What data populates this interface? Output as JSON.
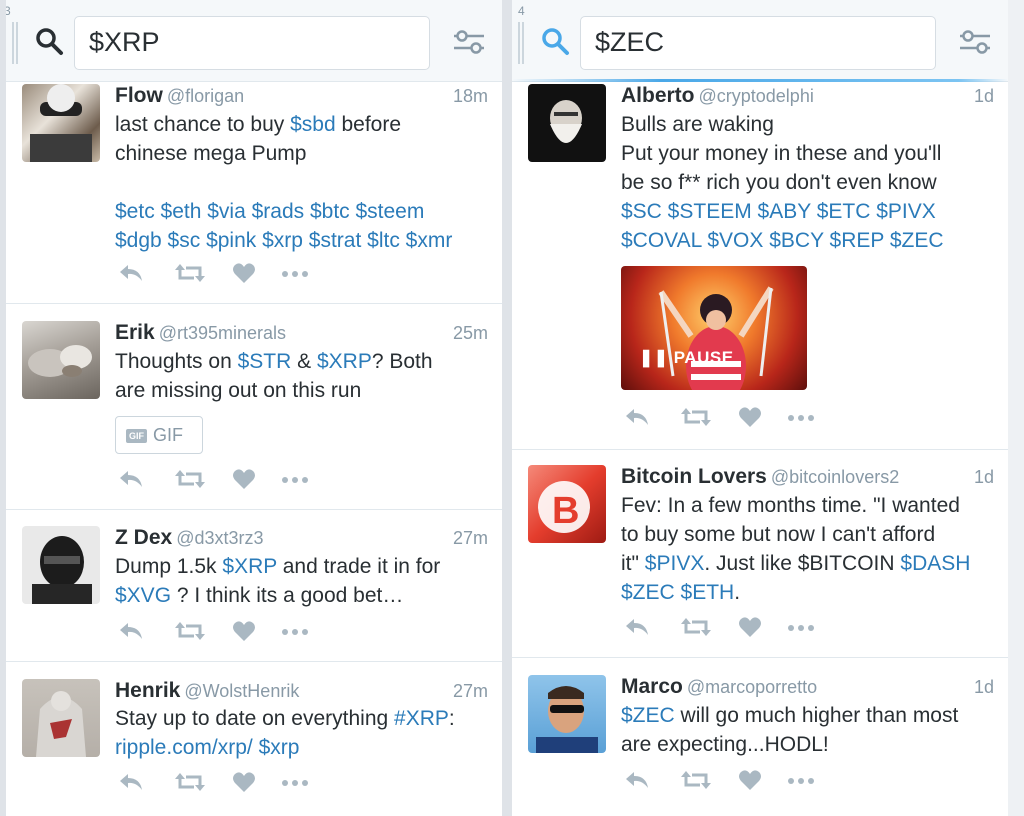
{
  "colors": {
    "link": "#2b7bb9",
    "text": "#292f33",
    "muted": "#8899a6"
  },
  "columns": [
    {
      "number": "3",
      "search": {
        "value": "$XRP"
      },
      "icons": {
        "search": "search-icon",
        "filter": "filter-sliders-icon"
      },
      "tweets": [
        {
          "name": "Flow",
          "handle": "@florigan",
          "time": "18m",
          "lines": [
            [
              {
                "t": "last chance to buy "
              },
              {
                "t": "$sbd",
                "link": true
              },
              {
                "t": " before"
              }
            ],
            [
              {
                "t": "chinese mega Pump"
              }
            ],
            [
              {
                "t": ""
              }
            ],
            [
              {
                "t": "$etc $eth $via $rads $btc $steem",
                "link": true
              }
            ],
            [
              {
                "t": "$dgb $sc $pink $xrp $strat $ltc $xmr",
                "link": true
              }
            ]
          ]
        },
        {
          "name": "Erik",
          "handle": "@rt395minerals",
          "time": "25m",
          "lines": [
            [
              {
                "t": "Thoughts on "
              },
              {
                "t": "$STR",
                "link": true
              },
              {
                "t": " & "
              },
              {
                "t": "$XRP",
                "link": true
              },
              {
                "t": "? Both"
              }
            ],
            [
              {
                "t": "are missing out on this run"
              }
            ]
          ],
          "gif": {
            "badge": "GIF",
            "label": "GIF"
          }
        },
        {
          "name": "Z Dex",
          "handle": "@d3xt3rz3",
          "time": "27m",
          "lines": [
            [
              {
                "t": "Dump 1.5k "
              },
              {
                "t": "$XRP",
                "link": true
              },
              {
                "t": " and trade it in for"
              }
            ],
            [
              {
                "t": "$XVG",
                "link": true
              },
              {
                "t": " ? I think its a good bet…"
              }
            ]
          ]
        },
        {
          "name": "Henrik",
          "handle": "@WolstHenrik",
          "time": "27m",
          "lines": [
            [
              {
                "t": "Stay up to date on everything "
              },
              {
                "t": "#XRP",
                "link": true
              },
              {
                "t": ":"
              }
            ],
            [
              {
                "t": "ripple.com/xrp/",
                "link": true
              },
              {
                "t": " "
              },
              {
                "t": "$xrp",
                "link": true
              }
            ]
          ]
        }
      ]
    },
    {
      "number": "4",
      "search": {
        "value": "$ZEC"
      },
      "icons": {
        "search": "search-icon",
        "filter": "filter-sliders-icon"
      },
      "tweets": [
        {
          "name": "Alberto",
          "handle": "@cryptodelphi",
          "time": "1d",
          "lines": [
            [
              {
                "t": "Bulls are waking"
              }
            ],
            [
              {
                "t": "Put your money in these and you'll"
              }
            ],
            [
              {
                "t": "be so f** rich you don't even know"
              }
            ],
            [
              {
                "t": "$SC $STEEM $ABY $ETC $PIVX",
                "link": true
              }
            ],
            [
              {
                "t": "$COVAL $VOX $BCY $REP $ZEC",
                "link": true
              }
            ]
          ],
          "media": {
            "label": "PAUSE",
            "icon": "pause-icon"
          }
        },
        {
          "name": "Bitcoin Lovers",
          "handle": "@bitcoinlovers2",
          "time": "1d",
          "lines": [
            [
              {
                "t": "Fev: In a few months time. \"I wanted"
              }
            ],
            [
              {
                "t": "to buy some but now I can't afford"
              }
            ],
            [
              {
                "t": "it\" "
              },
              {
                "t": "$PIVX",
                "link": true
              },
              {
                "t": ". Just like $BITCOIN "
              },
              {
                "t": "$DASH",
                "link": true
              }
            ],
            [
              {
                "t": "$ZEC $ETH",
                "link": true
              },
              {
                "t": "."
              }
            ]
          ]
        },
        {
          "name": "Marco",
          "handle": "@marcoporretto",
          "time": "1d",
          "lines": [
            [
              {
                "t": "$ZEC",
                "link": true
              },
              {
                "t": " will go much higher than most"
              }
            ],
            [
              {
                "t": "are expecting...HODL!"
              }
            ]
          ]
        }
      ]
    }
  ]
}
